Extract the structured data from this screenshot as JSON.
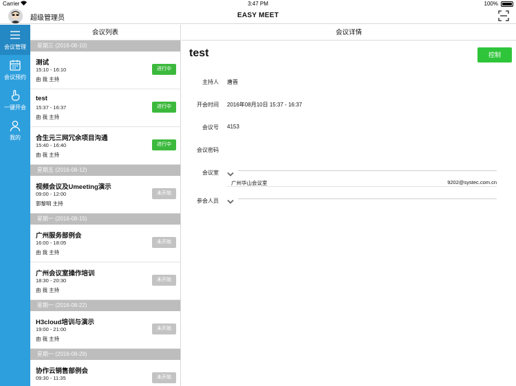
{
  "status_bar": {
    "carrier": "Carrier",
    "time": "3:47 PM",
    "battery": "100%"
  },
  "nav": {
    "username": "超级管理员",
    "app_title": "EASY MEET",
    "scan_icon": "scan-icon",
    "avatar_icon": "avatar-icon"
  },
  "sidebar": {
    "items": [
      {
        "label": "会议管理",
        "icon": "list-icon",
        "active": true
      },
      {
        "label": "会议预约",
        "icon": "calendar-icon",
        "active": false
      },
      {
        "label": "一键开会",
        "icon": "hand-tap-icon",
        "active": false
      },
      {
        "label": "我的",
        "icon": "person-icon",
        "active": false
      }
    ]
  },
  "list": {
    "title": "会议列表",
    "groups": [
      {
        "date": "星期三 (2016-08-10)",
        "meetings": [
          {
            "title": "测试",
            "time": "15:10 - 16:10",
            "host": "由 我 主持",
            "status": "进行中"
          },
          {
            "title": "test",
            "time": "15:37 - 16:37",
            "host": "由 我 主持",
            "status": "进行中"
          },
          {
            "title": "合生元三网冗余项目沟通",
            "time": "15:40 - 16:40",
            "host": "由 我 主持",
            "status": "进行中"
          }
        ]
      },
      {
        "date": "星期五 (2016-08-12)",
        "meetings": [
          {
            "title": "视频会议及Umeeting演示",
            "time": "09:00 - 12:00",
            "host": "郭黎明 主持",
            "status": "未开始"
          }
        ]
      },
      {
        "date": "星期一 (2016-08-15)",
        "meetings": [
          {
            "title": "广州服务部例会",
            "time": "16:00 - 18:05",
            "host": "由 我 主持",
            "status": "未开始"
          },
          {
            "title": "广州会议室操作培训",
            "time": "18:30 - 20:30",
            "host": "由 我 主持",
            "status": "未开始"
          }
        ]
      },
      {
        "date": "星期一 (2016-08-22)",
        "meetings": [
          {
            "title": "H3cloud培训与演示",
            "time": "19:00 - 21:00",
            "host": "由 我 主持",
            "status": "未开始"
          }
        ]
      },
      {
        "date": "星期一 (2016-08-29)",
        "meetings": [
          {
            "title": "协作云销售部例会",
            "time": "09:30 - 11:35",
            "host": "",
            "status": "未开始"
          }
        ]
      }
    ]
  },
  "detail": {
    "panel_title": "会议详情",
    "title": "test",
    "control_label": "控制",
    "host_label": "主持人",
    "host_value": "唐晋",
    "time_label": "开会时间",
    "time_value": "2016年08月10日 15:37 - 16:37",
    "number_label": "会议号",
    "number_value": "4153",
    "password_label": "会议密码",
    "password_value": "",
    "room_label": "会议室",
    "room_name": "广州华山会议室",
    "room_email": "9202@systec.com.cn",
    "participants_label": "参会人员"
  },
  "colors": {
    "sidebar": "#2e9fdd",
    "sidebar_active": "#2488c4",
    "in_progress": "#3cb93c",
    "not_started": "#c3c3c3",
    "control_button": "#2fc53a",
    "date_header": "#bdbdbd"
  }
}
